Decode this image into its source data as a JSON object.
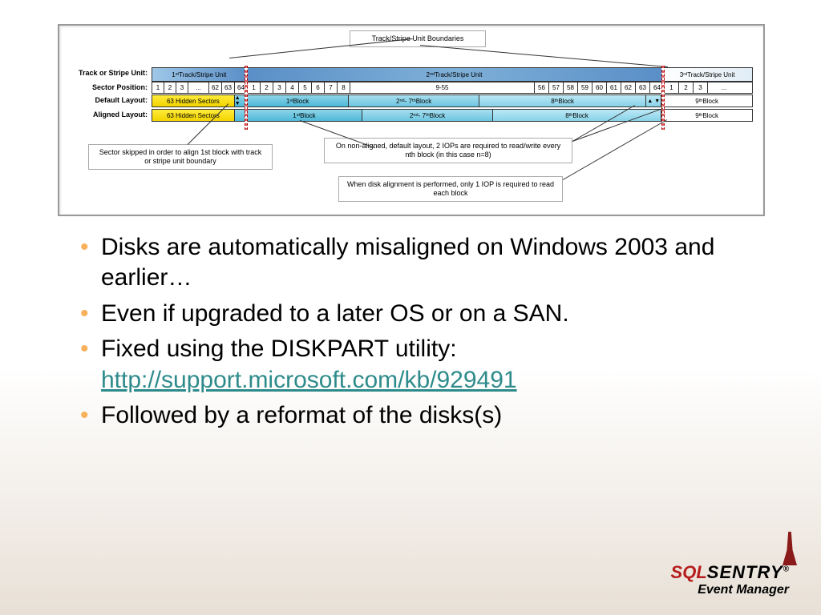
{
  "diagram": {
    "top_callout": "Track/Stripe Unit Boundaries",
    "row_labels": {
      "track": "Track or Stripe Unit:",
      "sector": "Sector Position:",
      "default": "Default Layout:",
      "aligned": "Aligned Layout:"
    },
    "tracks": {
      "t1_html": "1<span class='sup'>st</span> Track/Stripe Unit",
      "t2_html": "2<span class='sup'>nd</span> Track/Stripe Unit",
      "t3_html": "3<span class='sup'>rd</span> Track/Stripe Unit"
    },
    "sectors_g1": [
      "1",
      "2",
      "3",
      "...",
      "62",
      "63",
      "64"
    ],
    "sectors_g2a": [
      "1",
      "2",
      "3",
      "4",
      "5",
      "6",
      "7",
      "8"
    ],
    "sectors_g2mid": "9-55",
    "sectors_g2b": [
      "56",
      "57",
      "58",
      "59",
      "60",
      "61",
      "62",
      "63",
      "64"
    ],
    "sectors_g3": [
      "1",
      "2",
      "3",
      "..."
    ],
    "default_blocks": {
      "hidden": "63 Hidden Sectors",
      "b1_html": "1<span class='sup'>st</span> Block",
      "b2_html": "2<span class='sup'>nd</span> - 7<span class='sup'>th</span> Block",
      "b8_html": "8<span class='sup'>th</span> Block",
      "b9_html": "9<span class='sup'>th</span> Block"
    },
    "aligned_blocks": {
      "hidden": "63 Hidden Sectors",
      "b1_html": "1<span class='sup'>st</span> Block",
      "b2_html": "2<span class='sup'>nd</span> - 7<span class='sup'>th</span> Block",
      "b8_html": "8<span class='sup'>th</span> Block",
      "b9_html": "9<span class='sup'>th</span> Block"
    },
    "callouts": {
      "skip": "Sector skipped  in order to align 1st block with track or stripe unit boundary",
      "nonaligned": "On non-aligned, default layout, 2 IOPs are required to read/write every nth block (in this case n=8)",
      "aligned": "When disk alignment is performed, only 1 IOP is required to read each block"
    }
  },
  "bullets": [
    {
      "text": "Disks are automatically misaligned on Windows 2003 and earlier…"
    },
    {
      "text": "Even if upgraded to a later OS or on a SAN."
    },
    {
      "text": "Fixed using the DISKPART utility: ",
      "link": "http://support.microsoft.com/kb/929491"
    },
    {
      "text": "Followed by a reformat of the disks(s)"
    }
  ],
  "logo": {
    "sql": "SQL",
    "sentry": "SENTRY",
    "reg": "®",
    "sub": "Event Manager"
  }
}
